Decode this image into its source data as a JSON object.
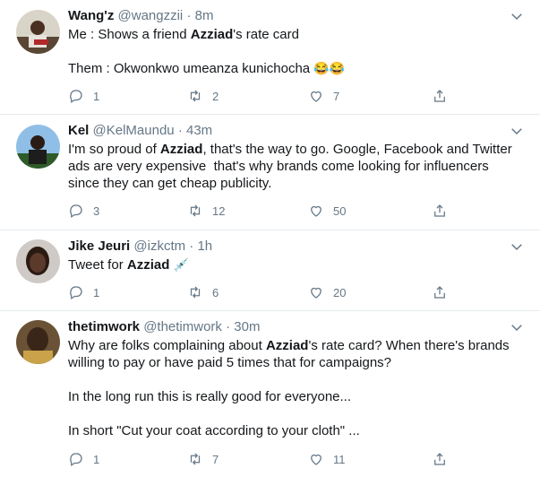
{
  "tweets": [
    {
      "name": "Wang'z",
      "handle": "@wangzzii",
      "time": "8m",
      "lines": [
        {
          "pre": "Me : Shows a friend ",
          "bold": "Azziad",
          "post": "'s rate card"
        },
        {
          "pre": "",
          "bold": "",
          "post": ""
        },
        {
          "pre": "Them : Okwonkwo umeanza kunichocha ",
          "bold": "",
          "post": "",
          "emoji": "😂😂"
        }
      ],
      "reply_count": "1",
      "retweet_count": "2",
      "like_count": "7"
    },
    {
      "name": "Kel",
      "handle": "@KelMaundu",
      "time": "43m",
      "lines": [
        {
          "pre": "I'm so proud of ",
          "bold": "Azziad",
          "post": ", that's the way to go. Google, Facebook and Twitter"
        },
        {
          "pre": "ads are very expensive  that's why brands come looking for influencers",
          "bold": "",
          "post": ""
        },
        {
          "pre": "since they can get cheap publicity.",
          "bold": "",
          "post": ""
        }
      ],
      "reply_count": "3",
      "retweet_count": "12",
      "like_count": "50"
    },
    {
      "name": "Jike Jeuri",
      "handle": "@izkctm",
      "time": "1h",
      "lines": [
        {
          "pre": "Tweet for ",
          "bold": "Azziad",
          "post": " ",
          "emoji": "💉"
        }
      ],
      "reply_count": "1",
      "retweet_count": "6",
      "like_count": "20"
    },
    {
      "name": "thetimwork",
      "handle": "@thetimwork",
      "time": "30m",
      "lines": [
        {
          "pre": "Why are folks complaining about ",
          "bold": "Azziad",
          "post": "'s rate card? When there's brands"
        },
        {
          "pre": "willing to pay or have paid 5 times that for campaigns?",
          "bold": "",
          "post": ""
        },
        {
          "pre": "",
          "bold": "",
          "post": ""
        },
        {
          "pre": "In the long run this is really good for everyone...",
          "bold": "",
          "post": ""
        },
        {
          "pre": "",
          "bold": "",
          "post": ""
        },
        {
          "pre": "In short \"Cut your coat according to your cloth\" ...",
          "bold": "",
          "post": ""
        }
      ],
      "reply_count": "1",
      "retweet_count": "7",
      "like_count": "11"
    }
  ],
  "colors": {
    "text": "#14171a",
    "secondary": "#657786",
    "border": "#e6ecf0"
  },
  "icons": {
    "reply": "reply-icon",
    "retweet": "retweet-icon",
    "like": "heart-icon",
    "share": "share-icon",
    "more": "chevron-down-icon"
  }
}
